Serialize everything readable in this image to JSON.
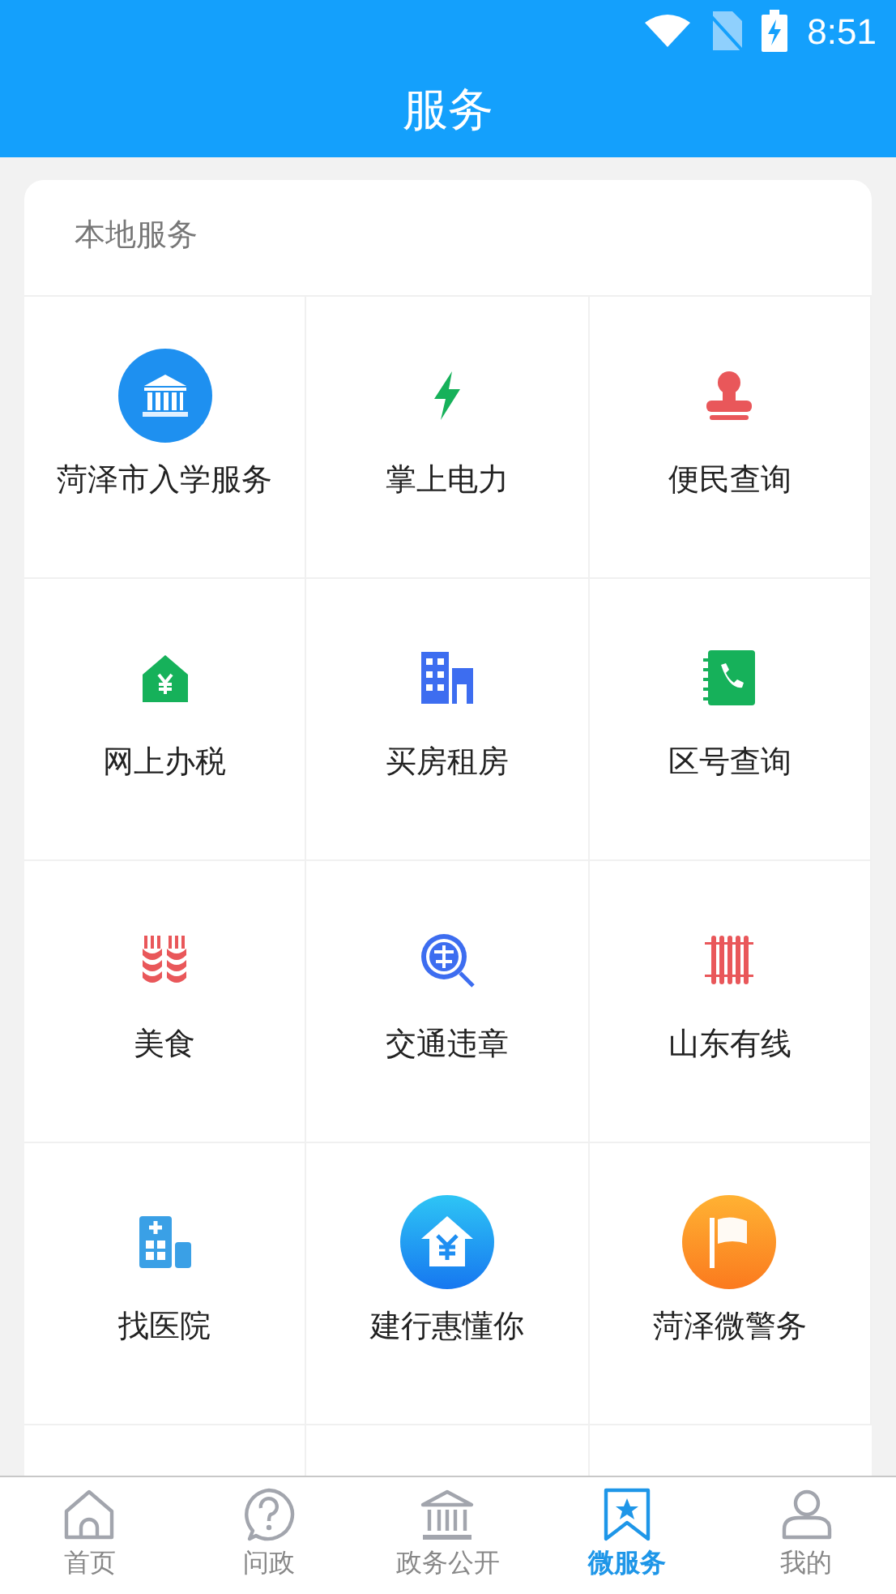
{
  "status_bar": {
    "time": "8:51"
  },
  "header": {
    "title": "服务"
  },
  "section": {
    "title": "本地服务"
  },
  "services": [
    {
      "label": "菏泽市入学服务",
      "kind": "bank-circle"
    },
    {
      "label": "掌上电力",
      "kind": "bolt"
    },
    {
      "label": "便民查询",
      "kind": "stamp"
    },
    {
      "label": "网上办税",
      "kind": "house-yen"
    },
    {
      "label": "买房租房",
      "kind": "buildings"
    },
    {
      "label": "区号查询",
      "kind": "phonebook"
    },
    {
      "label": "美食",
      "kind": "wheat"
    },
    {
      "label": "交通违章",
      "kind": "magnifier"
    },
    {
      "label": "山东有线",
      "kind": "radiator"
    },
    {
      "label": "找医院",
      "kind": "hospital"
    },
    {
      "label": "建行惠懂你",
      "kind": "house-yen-circle"
    },
    {
      "label": "菏泽微警务",
      "kind": "flag-circle"
    }
  ],
  "tabs": [
    {
      "label": "首页",
      "kind": "home",
      "selected": false
    },
    {
      "label": "问政",
      "kind": "question",
      "selected": false
    },
    {
      "label": "政务公开",
      "kind": "bank",
      "selected": false
    },
    {
      "label": "微服务",
      "kind": "bookmark-star",
      "selected": true
    },
    {
      "label": "我的",
      "kind": "user",
      "selected": false
    }
  ]
}
